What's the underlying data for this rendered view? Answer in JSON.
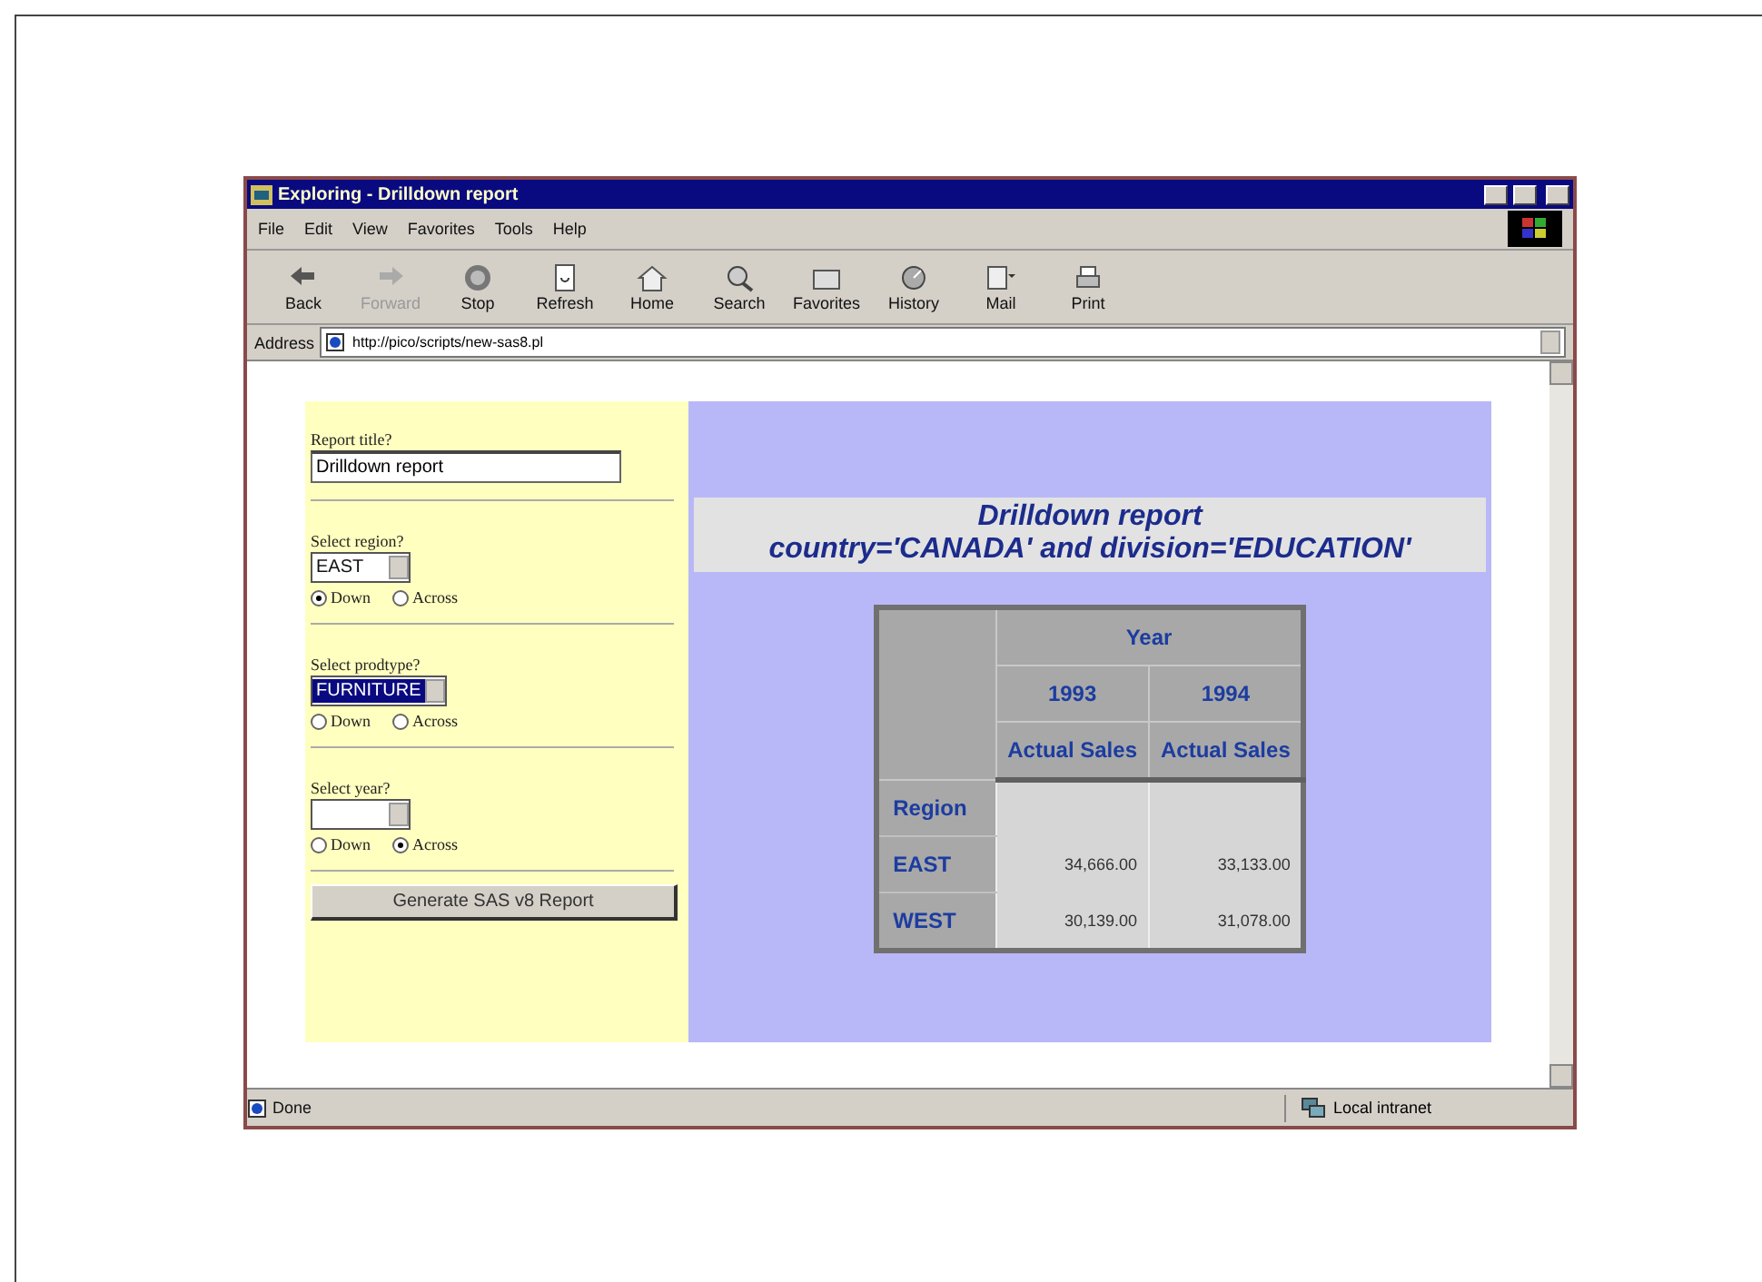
{
  "window": {
    "title": "Exploring - Drilldown report"
  },
  "menu": [
    "File",
    "Edit",
    "View",
    "Favorites",
    "Tools",
    "Help"
  ],
  "toolbar": [
    {
      "kind": "back",
      "label": "Back",
      "disabled": false
    },
    {
      "kind": "forward",
      "label": "Forward",
      "disabled": true
    },
    {
      "kind": "stop",
      "label": "Stop",
      "disabled": false
    },
    {
      "kind": "refresh",
      "label": "Refresh",
      "disabled": false
    },
    {
      "kind": "home",
      "label": "Home",
      "disabled": false
    },
    {
      "kind": "search",
      "label": "Search",
      "disabled": false
    },
    {
      "kind": "favorites",
      "label": "Favorites",
      "disabled": false
    },
    {
      "kind": "history",
      "label": "History",
      "disabled": false
    },
    {
      "kind": "mail",
      "label": "Mail",
      "disabled": false
    },
    {
      "kind": "print",
      "label": "Print",
      "disabled": false
    }
  ],
  "address": {
    "label": "Address",
    "url": "http://pico/scripts/new-sas8.pl"
  },
  "form": {
    "title_label": "Report title?",
    "title_value": "Drilldown report",
    "selects": [
      {
        "label": "Select region?",
        "value": "EAST",
        "highlighted": false,
        "options": [
          {
            "label": "Down",
            "selected": true
          },
          {
            "label": "Across",
            "selected": false
          }
        ]
      },
      {
        "label": "Select prodtype?",
        "value": "FURNITURE",
        "highlighted": true,
        "options": [
          {
            "label": "Down",
            "selected": false
          },
          {
            "label": "Across",
            "selected": false
          }
        ]
      },
      {
        "label": "Select year?",
        "highlighted": false,
        "options": [
          {
            "label": "Down",
            "selected": false
          },
          {
            "label": "Across",
            "selected": true
          }
        ]
      }
    ],
    "button": "Generate SAS v8 Report"
  },
  "report": {
    "title": "Drilldown report",
    "subtitle": "country='CANADA' and division='EDUCATION'",
    "table": {
      "group_header": "Year",
      "years": [
        "1993",
        "1994"
      ],
      "measure": [
        "Actual Sales",
        "Actual Sales"
      ],
      "row_header": "Region",
      "rows": [
        {
          "region": "EAST",
          "values": [
            "34,666.00",
            "33,133.00"
          ]
        },
        {
          "region": "WEST",
          "values": [
            "30,139.00",
            "31,078.00"
          ]
        }
      ]
    }
  },
  "status_bar": {
    "text": "Done",
    "zone": "Local intranet"
  }
}
